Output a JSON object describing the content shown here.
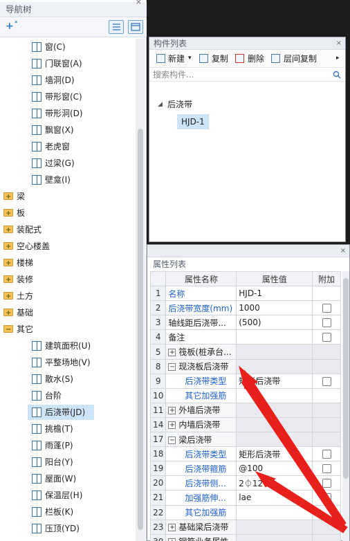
{
  "nav": {
    "title": "导航树",
    "tree_items": [
      {
        "label": "窗(C)",
        "icon": "window-icon"
      },
      {
        "label": "门联窗(A)",
        "icon": "door-window-icon"
      },
      {
        "label": "墙洞(D)",
        "icon": "wall-opening-icon"
      },
      {
        "label": "带形窗(C)",
        "icon": "strip-window-icon"
      },
      {
        "label": "带形洞(D)",
        "icon": "strip-opening-icon"
      },
      {
        "label": "飘窗(X)",
        "icon": "bay-window-icon"
      },
      {
        "label": "老虎窗",
        "icon": "dormer-window-icon"
      },
      {
        "label": "过梁(G)",
        "icon": "lintel-icon"
      },
      {
        "label": "壁龛(I)",
        "icon": "niche-icon"
      }
    ],
    "folders": [
      "梁",
      "板",
      "装配式",
      "空心楼盖",
      "楼梯",
      "装修",
      "土方",
      "基础",
      "其它"
    ],
    "other_items": [
      {
        "label": "建筑面积(U)",
        "icon": "building-area-icon"
      },
      {
        "label": "平整场地(V)",
        "icon": "site-leveling-icon"
      },
      {
        "label": "散水(S)",
        "icon": "apron-icon"
      },
      {
        "label": "台阶",
        "icon": "steps-icon"
      },
      {
        "label": "后浇带(JD)",
        "icon": "post-cast-strip-icon"
      },
      {
        "label": "挑檐(T)",
        "icon": "cornice-icon"
      },
      {
        "label": "雨蓬(P)",
        "icon": "canopy-icon"
      },
      {
        "label": "阳台(Y)",
        "icon": "balcony-icon"
      },
      {
        "label": "屋面(W)",
        "icon": "roof-icon"
      },
      {
        "label": "保温层(H)",
        "icon": "insulation-icon"
      },
      {
        "label": "栏板(K)",
        "icon": "parapet-icon"
      },
      {
        "label": "压顶(YD)",
        "icon": "coping-icon"
      }
    ]
  },
  "component_list": {
    "title": "构件列表",
    "toolbar": {
      "new": "新建",
      "copy": "复制",
      "delete": "删除",
      "floor_copy": "层间复制"
    },
    "search_placeholder": "搜索构件...",
    "tree_root": "后浇带",
    "tree_child": "HJD-1"
  },
  "properties": {
    "title": "属性列表",
    "headers": {
      "name": "属性名称",
      "value": "属性值",
      "extra": "附加"
    },
    "rows": [
      {
        "num": "1",
        "name": "名称",
        "value": "HJD-1"
      },
      {
        "num": "2",
        "name": "后浇带宽度(mm)",
        "value": "1000"
      },
      {
        "num": "3",
        "name": "轴线距后浇带...",
        "value": "(500)"
      },
      {
        "num": "4",
        "name": "备注",
        "value": ""
      },
      {
        "num": "5",
        "name": "筏板(桩承台...",
        "value": ""
      },
      {
        "num": "8",
        "name": "现浇板后浇带",
        "value": ""
      },
      {
        "num": "9",
        "name": "后浇带类型",
        "value": "矩形后浇带"
      },
      {
        "num": "10",
        "name": "其它加强筋",
        "value": ""
      },
      {
        "num": "11",
        "name": "外墙后浇带",
        "value": ""
      },
      {
        "num": "14",
        "name": "内墙后浇带",
        "value": ""
      },
      {
        "num": "17",
        "name": "梁后浇带",
        "value": ""
      },
      {
        "num": "18",
        "name": "后浇带类型",
        "value": "矩形后浇带"
      },
      {
        "num": "19",
        "name": "后浇带箍筋",
        "value": "@100"
      },
      {
        "num": "20",
        "name": "后浇带侧...",
        "value": "2⏀12"
      },
      {
        "num": "21",
        "name": "加强筋伸...",
        "value": "lae"
      },
      {
        "num": "22",
        "name": "其它加强筋",
        "value": ""
      },
      {
        "num": "23",
        "name": "基础梁后浇带",
        "value": ""
      },
      {
        "num": "30",
        "name": "钢筋业务属性",
        "value": ""
      }
    ]
  },
  "colors": {
    "accent_blue": "#1e5fd6",
    "arrow_red": "#e8201c",
    "selection": "#cde3f7"
  }
}
